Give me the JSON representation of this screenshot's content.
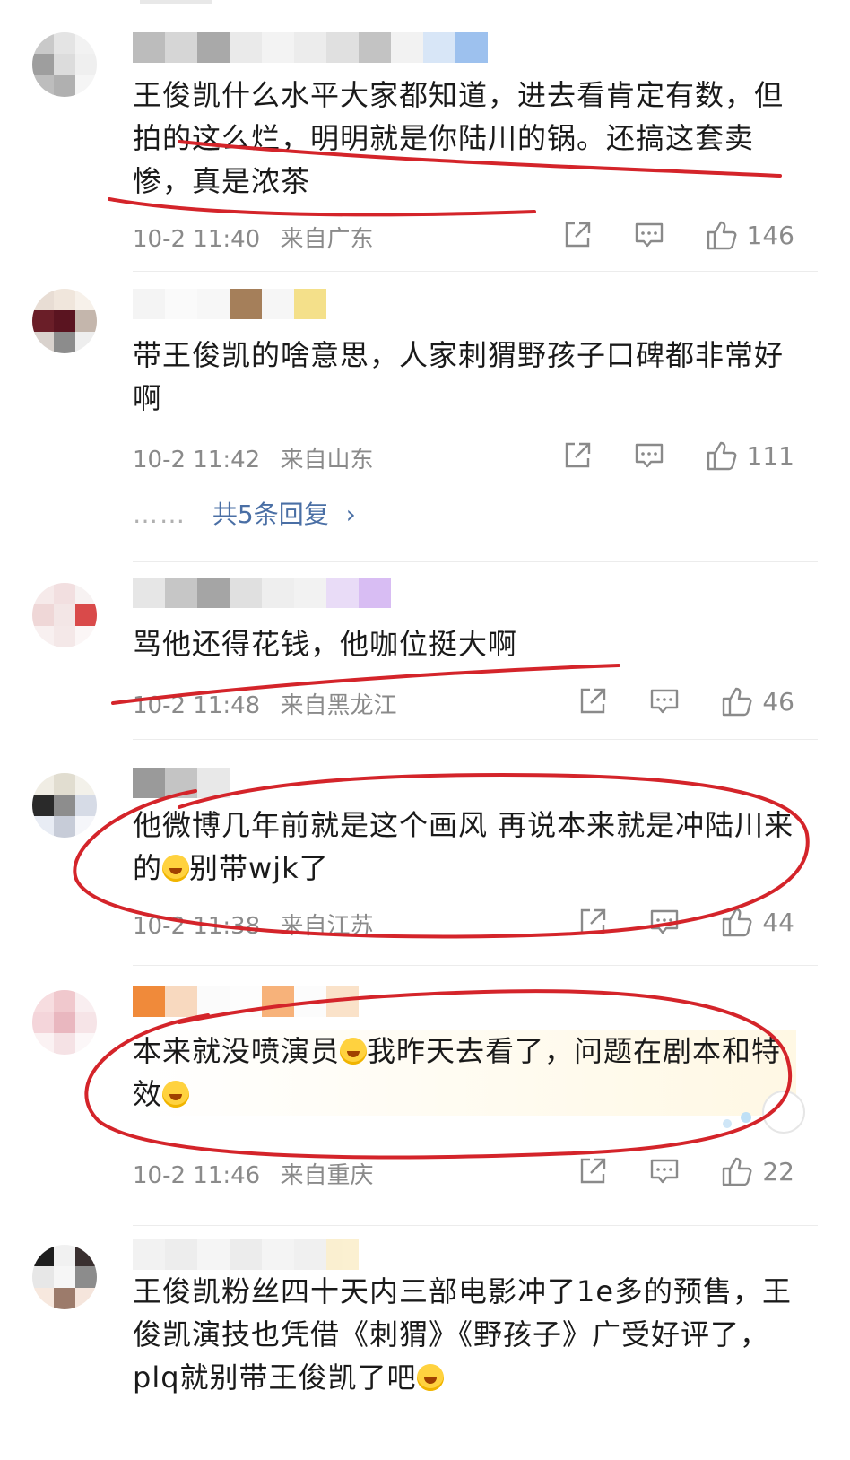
{
  "comments": [
    {
      "body": "王俊凯什么水平大家都知道，进去看肯定有数，但拍的这么烂，明明就是你陆川的锅。还搞这套卖惨，真是浓茶",
      "time": "10-2 11:40",
      "location": "来自广东",
      "likes": "146"
    },
    {
      "body": "带王俊凯的啥意思，人家刺猬野孩子口碑都非常好啊",
      "time": "10-2 11:42",
      "location": "来自山东",
      "likes": "111",
      "replies_dots": "……",
      "replies_label": "共5条回复",
      "replies_arrow": "›"
    },
    {
      "body": "骂他还得花钱，他咖位挺大啊",
      "time": "10-2 11:48",
      "location": "来自黑龙江",
      "likes": "46"
    },
    {
      "body_a": "他微博几年前就是这个画风  再说本来就是冲陆川来的",
      "body_b": "别带wjk了",
      "time": "10-2 11:38",
      "location": "来自江苏",
      "likes": "44"
    },
    {
      "body_a": "本来就没喷演员",
      "body_b": "我昨天去看了，问题在剧本和特效",
      "time": "10-2 11:46",
      "location": "来自重庆",
      "likes": "22"
    },
    {
      "body_a": "王俊凯粉丝四十天内三部电影冲了1e多的预售，王俊凯演技也凭借《刺猬》《野孩子》广受好评了，plq就别带王俊凯了吧"
    }
  ],
  "colors": {
    "annotation_red": "#d4242a",
    "meta_gray": "#8a8a8a",
    "reply_link": "#4a6fa5"
  },
  "icons": [
    "share-icon",
    "comment-icon",
    "like-icon",
    "laugh-cry-emoji"
  ]
}
